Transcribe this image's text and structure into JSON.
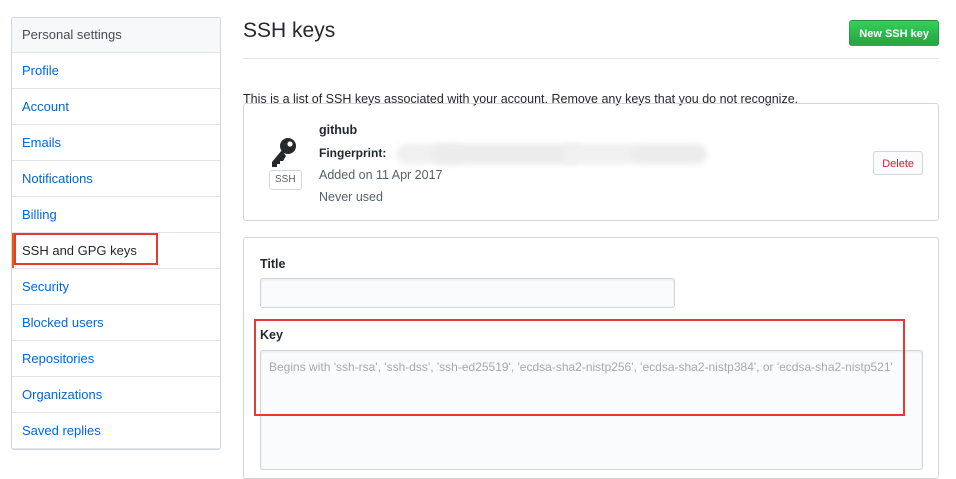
{
  "sidebar": {
    "header": "Personal settings",
    "items": [
      {
        "label": "Profile"
      },
      {
        "label": "Account"
      },
      {
        "label": "Emails"
      },
      {
        "label": "Notifications"
      },
      {
        "label": "Billing"
      },
      {
        "label": "SSH and GPG keys",
        "selected": true
      },
      {
        "label": "Security"
      },
      {
        "label": "Blocked users"
      },
      {
        "label": "Repositories"
      },
      {
        "label": "Organizations"
      },
      {
        "label": "Saved replies"
      }
    ]
  },
  "main": {
    "title": "SSH keys",
    "new_key_button": "New SSH key",
    "intro": "This is a list of SSH keys associated with your account. Remove any keys that you do not recognize.",
    "key": {
      "icon": "key-icon",
      "badge": "SSH",
      "name": "github",
      "fingerprint_label": "Fingerprint:",
      "added_on": "Added on 11 Apr 2017",
      "last_used": "Never used",
      "delete_button": "Delete"
    },
    "form": {
      "title_label": "Title",
      "title_value": "",
      "key_label": "Key",
      "key_placeholder": "Begins with 'ssh-rsa', 'ssh-dss', 'ssh-ed25519', 'ecdsa-sha2-nistp256', 'ecdsa-sha2-nistp384', or 'ecdsa-sha2-nistp521'"
    }
  },
  "colors": {
    "link": "#0366d6",
    "primary_button": "#28a745",
    "danger_text": "#cb2431",
    "annotation_red": "#e53935"
  }
}
